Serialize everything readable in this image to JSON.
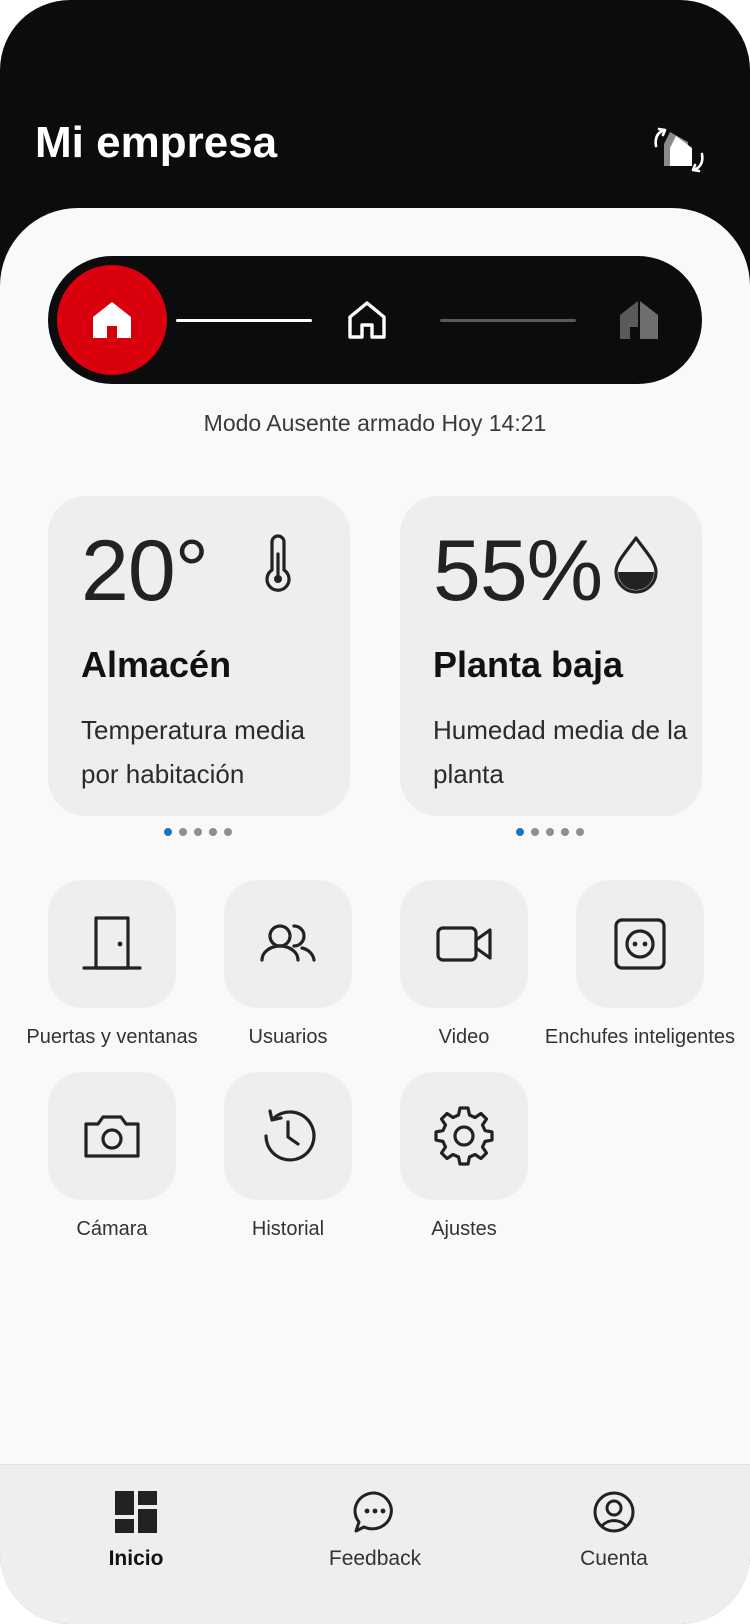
{
  "header": {
    "title": "Mi empresa",
    "switch_icon": "home-switch-icon"
  },
  "mode_selector": {
    "modes": [
      {
        "name": "away",
        "icon": "home-filled-icon",
        "active": true
      },
      {
        "name": "home",
        "icon": "home-outline-icon",
        "active": false
      },
      {
        "name": "night",
        "icon": "home-dim-icon",
        "active": false
      }
    ],
    "active_color": "#d9000d",
    "status_text": "Modo Ausente armado Hoy 14:21"
  },
  "cards": [
    {
      "value": "20°",
      "title": "Almacén",
      "description": "Temperatura media por habitación",
      "icon": "thermometer-icon",
      "page_index": 1,
      "page_count": 5
    },
    {
      "value": "55%",
      "title": "Planta baja",
      "description": "Humedad media de la planta",
      "icon": "droplet-icon",
      "page_index": 1,
      "page_count": 5
    }
  ],
  "tiles": [
    {
      "label": "Puertas y ventanas",
      "icon": "door-icon"
    },
    {
      "label": "Usuarios",
      "icon": "users-icon"
    },
    {
      "label": "Video",
      "icon": "video-icon"
    },
    {
      "label": "Enchufes inteligentes",
      "icon": "smart-plug-icon"
    },
    {
      "label": "Cámara",
      "icon": "camera-icon"
    },
    {
      "label": "Historial",
      "icon": "history-icon"
    },
    {
      "label": "Ajustes",
      "icon": "settings-icon"
    }
  ],
  "bottom_nav": [
    {
      "label": "Inicio",
      "icon": "dashboard-icon",
      "active": true
    },
    {
      "label": "Feedback",
      "icon": "feedback-icon",
      "active": false
    },
    {
      "label": "Cuenta",
      "icon": "account-icon",
      "active": false
    }
  ],
  "colors": {
    "accent": "#d9000d",
    "dot_active": "#1b75b8",
    "header_bg": "#0c0c0c"
  }
}
